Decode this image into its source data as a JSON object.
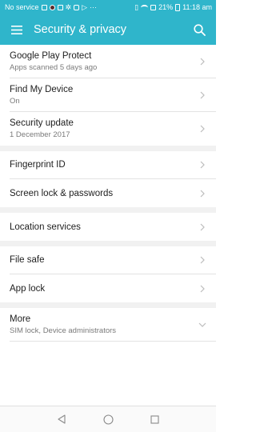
{
  "status_bar": {
    "carrier": "No service",
    "battery": "21%",
    "time": "11:18 am",
    "icons": [
      "sim-icon",
      "notification-icon",
      "app-icon",
      "settings-icon",
      "instagram-icon",
      "play-icon",
      "more-dots-icon",
      "vibrate-icon",
      "wifi-icon",
      "sim-card-icon",
      "battery-icon"
    ]
  },
  "app_bar": {
    "title": "Security & privacy",
    "menu_icon": "menu-icon",
    "search_icon": "search-icon"
  },
  "groups": [
    {
      "items": [
        {
          "title": "Google Play Protect",
          "subtitle": "Apps scanned 5 days ago"
        },
        {
          "title": "Find My Device",
          "subtitle": "On"
        },
        {
          "title": "Security update",
          "subtitle": "1 December 2017"
        }
      ]
    },
    {
      "items": [
        {
          "title": "Fingerprint ID"
        },
        {
          "title": "Screen lock & passwords"
        }
      ]
    },
    {
      "items": [
        {
          "title": "Location services"
        }
      ]
    },
    {
      "items": [
        {
          "title": "File safe"
        },
        {
          "title": "App lock"
        }
      ]
    },
    {
      "items": [
        {
          "title": "More",
          "subtitle": "SIM lock, Device administrators"
        }
      ]
    }
  ],
  "nav_bar": {
    "icons": [
      "back-icon",
      "home-icon",
      "recents-icon"
    ]
  },
  "colors": {
    "accent": "#2fb5cb",
    "divider": "#e3e3e3",
    "group_gap": "#f1f1f1"
  }
}
